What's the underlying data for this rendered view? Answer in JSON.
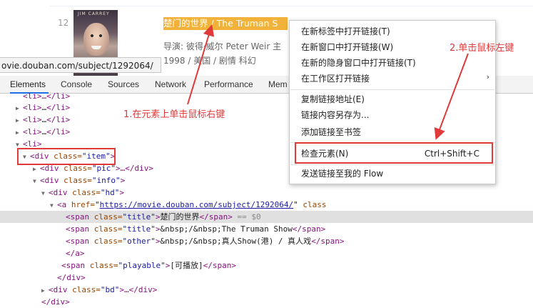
{
  "page": {
    "rank": "12",
    "poster_caption": "JIM CARREY",
    "title_cn": "楚门的世界",
    "title_en": " / The Truman S",
    "director": "导演: 彼得·威尔 Peter Weir   主",
    "meta": "1998 / 美国 / 剧情 科幻"
  },
  "url_tooltip": "ovie.douban.com/subject/1292064/",
  "devtools": {
    "tabs": [
      "Elements",
      "Console",
      "Sources",
      "Network",
      "Performance",
      "Mem"
    ],
    "active_tab": "Elements"
  },
  "dom": {
    "r0": "<li>…</li>",
    "r1a": "<li>",
    "r1b": "…",
    "r1c": "</li>",
    "r2a": "<li>",
    "r2b": "…",
    "r2c": "</li>",
    "r3a": "<li>",
    "r3b": "…",
    "r3c": "</li>",
    "r4": "<li>",
    "item_open": "<div",
    "item_attr": "class=",
    "item_val": "\"item\"",
    "item_close": ">",
    "pic_open": "<div",
    "pic_attr": "class=",
    "pic_val": "\"pic\"",
    "pic_rest": ">…</div>",
    "info_open": "<div",
    "info_attr": "class=",
    "info_val": "\"info\"",
    "info_close": ">",
    "hd_open": "<div",
    "hd_attr": "class=",
    "hd_val": "\"hd\"",
    "hd_close": ">",
    "a_open": "<a",
    "a_attr": "href=",
    "a_href": "https://movie.douban.com/subject/1292064/",
    "a_rest": " class",
    "s1_open": "<span",
    "s1_attr": "class=",
    "s1_val": "\"title\"",
    "s1_text": "楚门的世界",
    "s1_close": "</span>",
    "s1_eq": " == $0",
    "s2_open": "<span",
    "s2_attr": "class=",
    "s2_val": "\"title\"",
    "s2_text": "&nbsp;/&nbsp;The Truman Show",
    "s2_close": "</span>",
    "s3_open": "<span",
    "s3_attr": "class=",
    "s3_val": "\"other\"",
    "s3_text": "&nbsp;/&nbsp;真人Show(港)  /  真人戏",
    "s3_close": "</span>",
    "a_end": "</a>",
    "p_open": "<span",
    "p_attr": "class=",
    "p_val": "\"playable\"",
    "p_text": "[可播放]",
    "p_close": "</span>",
    "div_end1": "</div>",
    "bd_open": "<div",
    "bd_attr": "class=",
    "bd_val": "\"bd\"",
    "bd_rest": ">…</div>",
    "div_end2": "</div>"
  },
  "context_menu": {
    "items": [
      "在新标签中打开链接(T)",
      "在新窗口中打开链接(W)",
      "在新的隐身窗口中打开链接(T)",
      "在工作区打开链接",
      "复制链接地址(E)",
      "链接内容另存为...",
      "添加链接至书签",
      "检查元素(N)",
      "发送链接至我的 Flow"
    ],
    "inspect_shortcut": "Ctrl+Shift+C"
  },
  "annotations": {
    "step1": "1.在元素上单击鼠标右键",
    "step2": "2.单击鼠标左键",
    "color": "#e03a3a"
  }
}
